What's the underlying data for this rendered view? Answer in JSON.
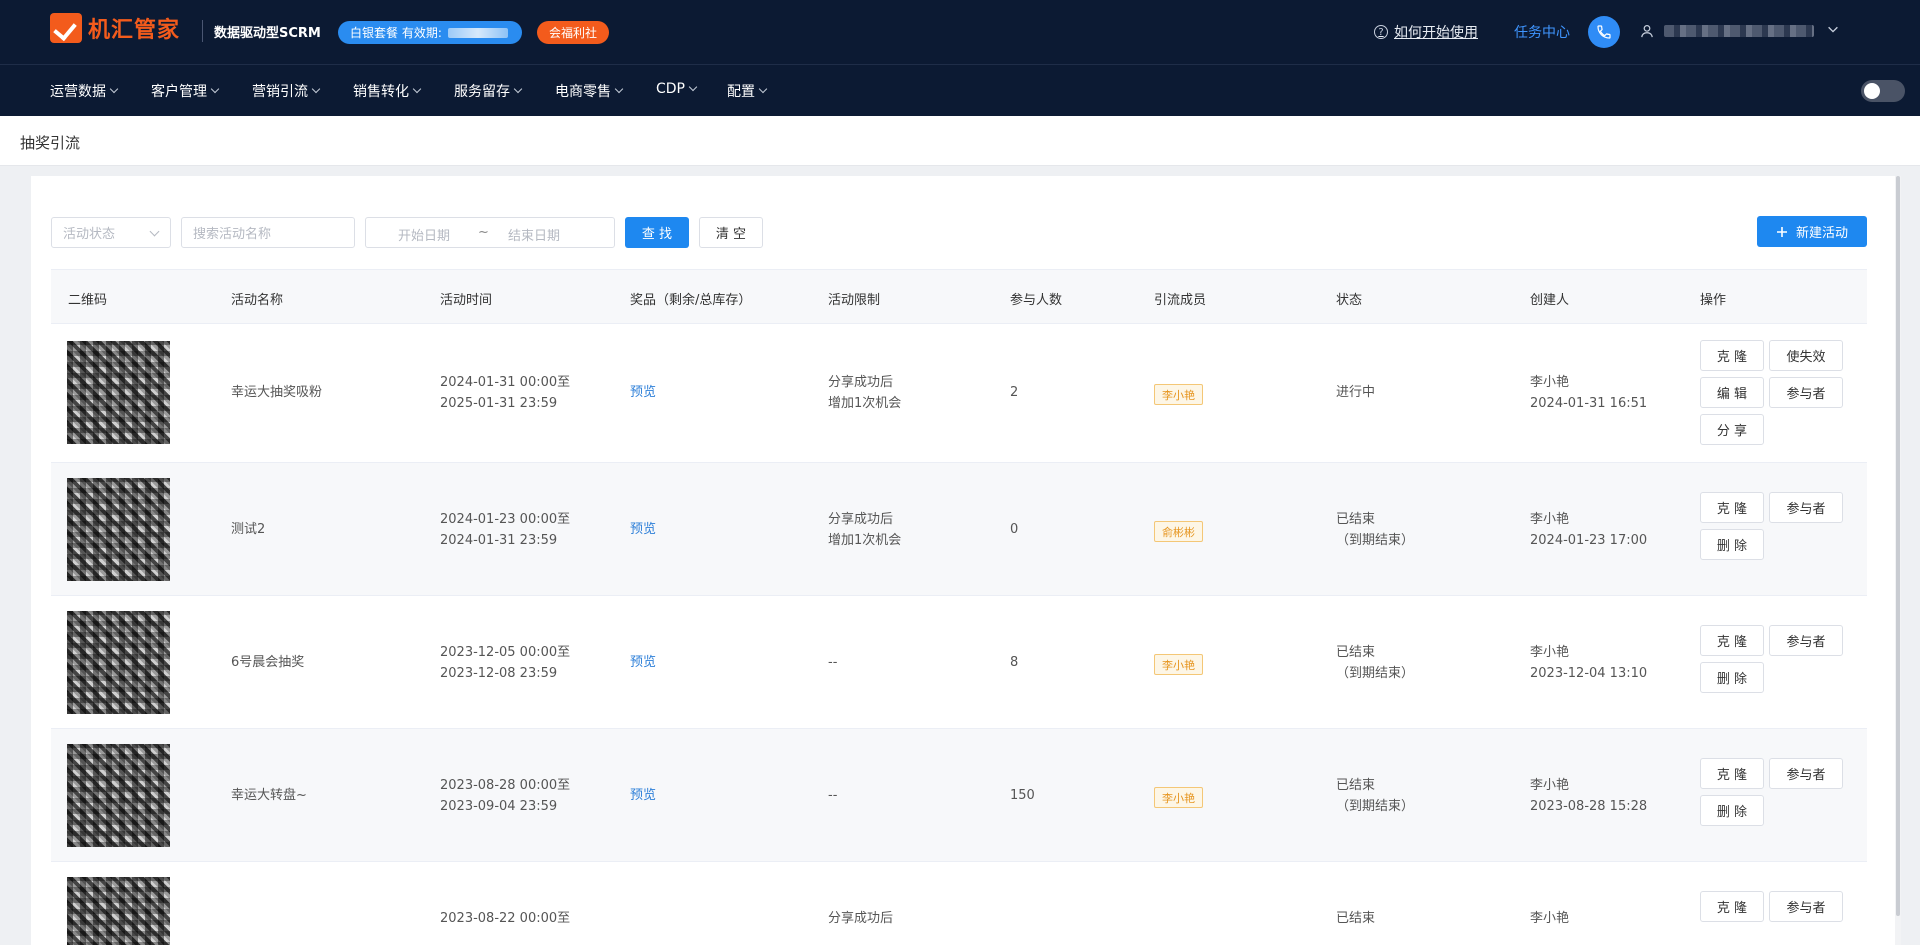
{
  "header": {
    "logo_text": "机汇管家",
    "tagline": "数据驱动型SCRM",
    "plan_label": "白银套餐 有效期:",
    "welfare_label": "会福利社",
    "help_label": "如何开始使用",
    "task_label": "任务中心"
  },
  "nav": {
    "items": [
      {
        "label": "运营数据"
      },
      {
        "label": "客户管理"
      },
      {
        "label": "营销引流"
      },
      {
        "label": "销售转化"
      },
      {
        "label": "服务留存"
      },
      {
        "label": "电商零售"
      },
      {
        "label": "CDP"
      },
      {
        "label": "配置"
      }
    ]
  },
  "breadcrumb": "抽奖引流",
  "filters": {
    "status_placeholder": "活动状态",
    "name_placeholder": "搜索活动名称",
    "start_placeholder": "开始日期",
    "range_sep": "~",
    "end_placeholder": "结束日期",
    "search_label": "查 找",
    "clear_label": "清 空",
    "new_label": "新建活动"
  },
  "table": {
    "columns": [
      "二维码",
      "活动名称",
      "活动时间",
      "奖品（剩余/总库存）",
      "活动限制",
      "参与人数",
      "引流成员",
      "状态",
      "创建人",
      "操作"
    ],
    "rows": [
      {
        "name": "幸运大抽奖吸粉",
        "time1": "2024-01-31 00:00至",
        "time2": "2025-01-31 23:59",
        "prize": "预览",
        "limit1": "分享成功后",
        "limit2": "增加1次机会",
        "count": "2",
        "member": "李小艳",
        "status1": "进行中",
        "status2": "",
        "creator": "李小艳",
        "created": "2024-01-31 16:51",
        "ops": [
          "克 隆",
          "使失效",
          "编 辑",
          "参与者",
          "分 享"
        ]
      },
      {
        "name": "测试2",
        "time1": "2024-01-23 00:00至",
        "time2": "2024-01-31 23:59",
        "prize": "预览",
        "limit1": "分享成功后",
        "limit2": "增加1次机会",
        "count": "0",
        "member": "俞彬彬",
        "status1": "已结束",
        "status2": "（到期结束）",
        "creator": "李小艳",
        "created": "2024-01-23 17:00",
        "ops": [
          "克 隆",
          "参与者",
          "删 除"
        ]
      },
      {
        "name": "6号晨会抽奖",
        "time1": "2023-12-05 00:00至",
        "time2": "2023-12-08 23:59",
        "prize": "预览",
        "limit1": "--",
        "limit2": "",
        "count": "8",
        "member": "李小艳",
        "status1": "已结束",
        "status2": "（到期结束）",
        "creator": "李小艳",
        "created": "2023-12-04 13:10",
        "ops": [
          "克 隆",
          "参与者",
          "删 除"
        ]
      },
      {
        "name": "幸运大转盘~",
        "time1": "2023-08-28 00:00至",
        "time2": "2023-09-04 23:59",
        "prize": "预览",
        "limit1": "--",
        "limit2": "",
        "count": "150",
        "member": "李小艳",
        "status1": "已结束",
        "status2": "（到期结束）",
        "creator": "李小艳",
        "created": "2023-08-28 15:28",
        "ops": [
          "克 隆",
          "参与者",
          "删 除"
        ]
      },
      {
        "name": "",
        "time1": "2023-08-22 00:00至",
        "time2": "",
        "prize": "",
        "limit1": "分享成功后",
        "limit2": "",
        "count": "",
        "member": "",
        "status1": "已结束",
        "status2": "",
        "creator": "李小艳",
        "created": "",
        "ops": [
          "克 隆",
          "参与者"
        ]
      }
    ]
  },
  "icons": {
    "help": "question-circle-icon",
    "phone": "phone-icon",
    "user": "user-icon",
    "chevron": "chevron-down-icon",
    "plus": "plus-icon"
  },
  "colors": {
    "header_bg": "#0c1a33",
    "brand_orange": "#f35b1c",
    "primary_blue": "#1e88f0",
    "tag_orange": "#e6951f"
  }
}
